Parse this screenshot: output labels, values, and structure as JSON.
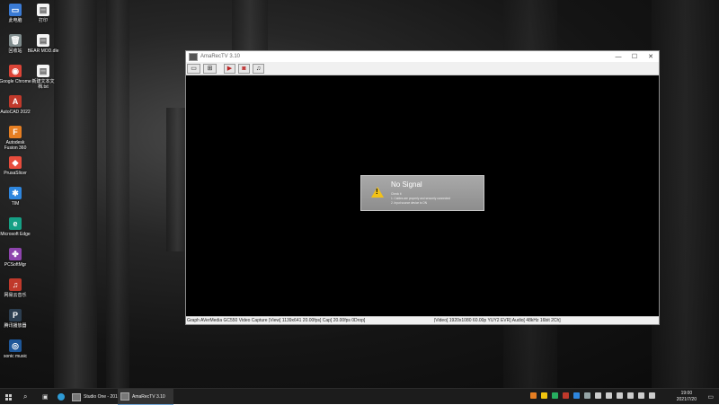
{
  "desktop_icons": [
    {
      "label": "此电脑",
      "icon": "computer-icon",
      "color": "#3a7bd5",
      "glyph": "▭"
    },
    {
      "label": "回收站",
      "icon": "recycle-bin-icon",
      "color": "#7f8c8d",
      "glyph": "🗑"
    },
    {
      "label": "Google Chrome",
      "icon": "chrome-icon",
      "color": "#db4437",
      "glyph": "◉"
    },
    {
      "label": "AutoCAD 2022",
      "icon": "autocad-icon",
      "color": "#c0392b",
      "glyph": "A"
    },
    {
      "label": "Autodesk Fusion 360",
      "icon": "fusion360-icon",
      "color": "#e67e22",
      "glyph": "F"
    },
    {
      "label": "PrusaSlicer",
      "icon": "prusaslicer-icon",
      "color": "#e74c3c",
      "glyph": "◆"
    },
    {
      "label": "TIM",
      "icon": "tim-icon",
      "color": "#2e86de",
      "glyph": "✱"
    },
    {
      "label": "Microsoft Edge",
      "icon": "edge-icon",
      "color": "#16a085",
      "glyph": "e"
    },
    {
      "label": "PCSoftMgr",
      "icon": "pcsoftmgr-icon",
      "color": "#8e44ad",
      "glyph": "✤"
    },
    {
      "label": "网易云音乐",
      "icon": "netease-music-icon",
      "color": "#c0392b",
      "glyph": "♫"
    },
    {
      "label": "腾讯播放器",
      "icon": "video-player-icon",
      "color": "#2c3e50",
      "glyph": "P"
    },
    {
      "label": "sonic music",
      "icon": "headphones-icon",
      "color": "#1e5799",
      "glyph": "◎"
    }
  ],
  "desktop_icons_col2": [
    {
      "label": "打印",
      "icon": "document-icon",
      "color": "#f5f5f5",
      "glyph": "▤"
    },
    {
      "label": "BEAR MOD.dle",
      "icon": "file-icon",
      "color": "#f5f5f5",
      "glyph": "▤"
    },
    {
      "label": "新建文本文档.txt",
      "icon": "text-file-icon",
      "color": "#f5f5f5",
      "glyph": "▤"
    }
  ],
  "window": {
    "title": "AmaRecTV 3.10",
    "minimize": "—",
    "maximize": "☐",
    "close": "✕"
  },
  "toolbar": [
    {
      "name": "settings-button",
      "glyph": "▭"
    },
    {
      "name": "graph-button",
      "glyph": "⊞"
    },
    {
      "name": "record-button",
      "glyph": "▶"
    },
    {
      "name": "capture-button",
      "glyph": "◙"
    },
    {
      "name": "audio-button",
      "glyph": "♫"
    }
  ],
  "no_signal": {
    "heading": "No Signal",
    "check": "Check it",
    "line1": "1. Cables are properly and securely connected",
    "line2": "2. Input source device is ON"
  },
  "statusbar": {
    "left": "Graph AVerMedia GC550 Video Capture  |View[ 1139x641 20.00fps]  Cap[ 20.00fps 0Drop]",
    "right": "|Video[ 1920x1080 60.00p YUY2 EVR]  Audio[ 48kHz 16bit 2Ch]"
  },
  "taskbar": {
    "apps": [
      {
        "label": "Studio One - 201...",
        "icon": "studio-one-icon"
      },
      {
        "label": "AmaRecTV 3.10",
        "icon": "amarectv-icon"
      }
    ],
    "time": "19:00",
    "date": "2021/7/20"
  },
  "tray_colors": [
    "#e67e22",
    "#f1c40f",
    "#27ae60",
    "#c0392b",
    "#2e86de",
    "#95a5a6",
    "#ccc",
    "#ccc",
    "#ccc",
    "#ccc",
    "#ccc",
    "#ccc"
  ]
}
